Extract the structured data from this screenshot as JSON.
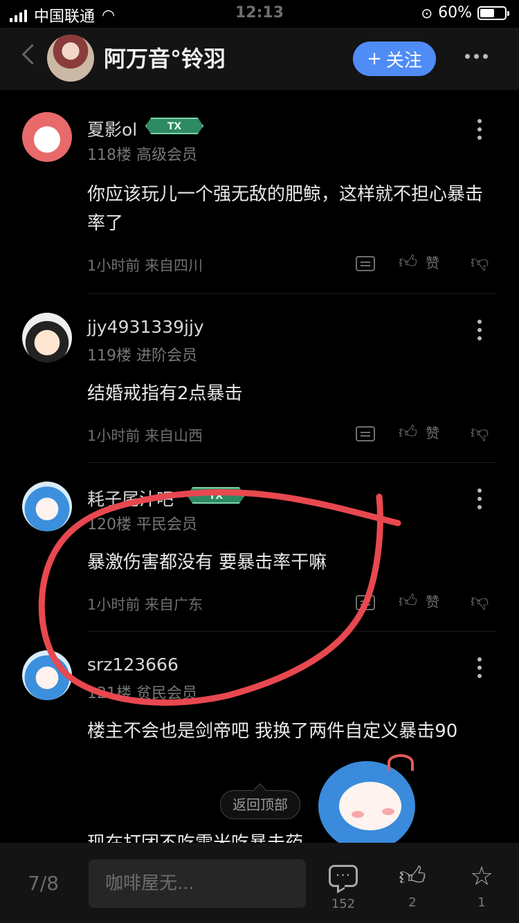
{
  "status_bar": {
    "carrier": "中国联通",
    "time": "12:13",
    "battery": "60%",
    "battery_level": 0.6
  },
  "header": {
    "title": "阿万音°铃羽",
    "follow_label": "关注",
    "follow_plus": "+"
  },
  "posts": [
    {
      "username": "夏影ol",
      "badge": "TX",
      "floor": "118楼",
      "rank": "高级会员",
      "content": "你应该玩儿一个强无敌的肥鲸，这样就不担心暴击率了",
      "time": "1小时前 来自四川",
      "like_label": "赞"
    },
    {
      "username": "jjy4931339jjy",
      "floor": "119楼",
      "rank": "进阶会员",
      "content": "结婚戒指有2点暴击",
      "time": "1小时前 来自山西",
      "like_label": "赞"
    },
    {
      "username": "耗子尾汁吧",
      "badge": "TX",
      "floor": "120楼",
      "rank": "平民会员",
      "content": "暴激伤害都没有 要暴击率干嘛",
      "time": "1小时前 来自广东",
      "like_label": "赞"
    },
    {
      "username": "srz123666",
      "floor": "121楼",
      "rank": "贫民会员",
      "content": "楼主不会也是剑帝吧  我换了两件自定义暴击90",
      "content2": "现在打团不吃雷米吃暴击药"
    }
  ],
  "back_to_top": "返回顶部",
  "bottom_bar": {
    "page": "7/8",
    "input_placeholder": "咖啡屋无...",
    "comments": "152",
    "likes": "2",
    "favorites": "1"
  },
  "annotation_color": "#e8484f"
}
